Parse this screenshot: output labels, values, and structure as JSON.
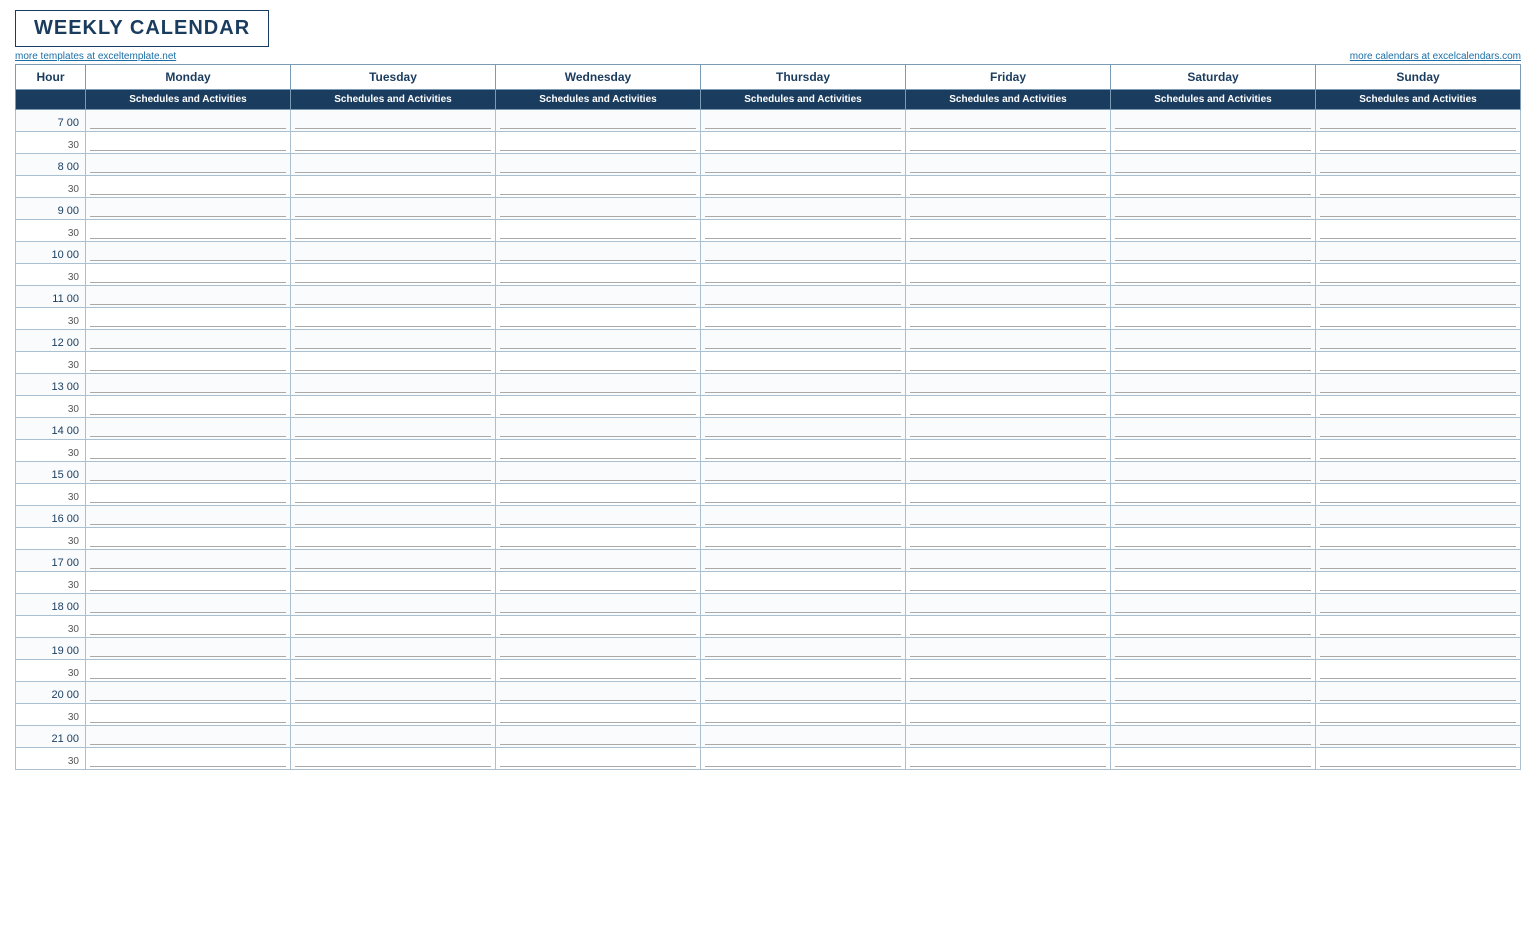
{
  "header": {
    "title": "WEEKLY CALENDAR",
    "link_left": "more templates at exceltemplate.net",
    "link_right": "more calendars at excelcalendars.com"
  },
  "columns": {
    "hour_label": "Hour",
    "days": [
      "Monday",
      "Tuesday",
      "Wednesday",
      "Thursday",
      "Friday",
      "Saturday",
      "Sunday"
    ],
    "sub_label": "Schedules and Activities"
  },
  "time_slots": [
    {
      "hour": "7  00",
      "half": "30"
    },
    {
      "hour": "8  00",
      "half": "30"
    },
    {
      "hour": "9  00",
      "half": "30"
    },
    {
      "hour": "10  00",
      "half": "30"
    },
    {
      "hour": "11  00",
      "half": "30"
    },
    {
      "hour": "12  00",
      "half": "30"
    },
    {
      "hour": "13  00",
      "half": "30"
    },
    {
      "hour": "14  00",
      "half": "30"
    },
    {
      "hour": "15  00",
      "half": "30"
    },
    {
      "hour": "16  00",
      "half": "30"
    },
    {
      "hour": "17  00",
      "half": "30"
    },
    {
      "hour": "18  00",
      "half": "30"
    },
    {
      "hour": "19  00",
      "half": "30"
    },
    {
      "hour": "20  00",
      "half": "30"
    },
    {
      "hour": "21  00",
      "half": "30"
    }
  ]
}
